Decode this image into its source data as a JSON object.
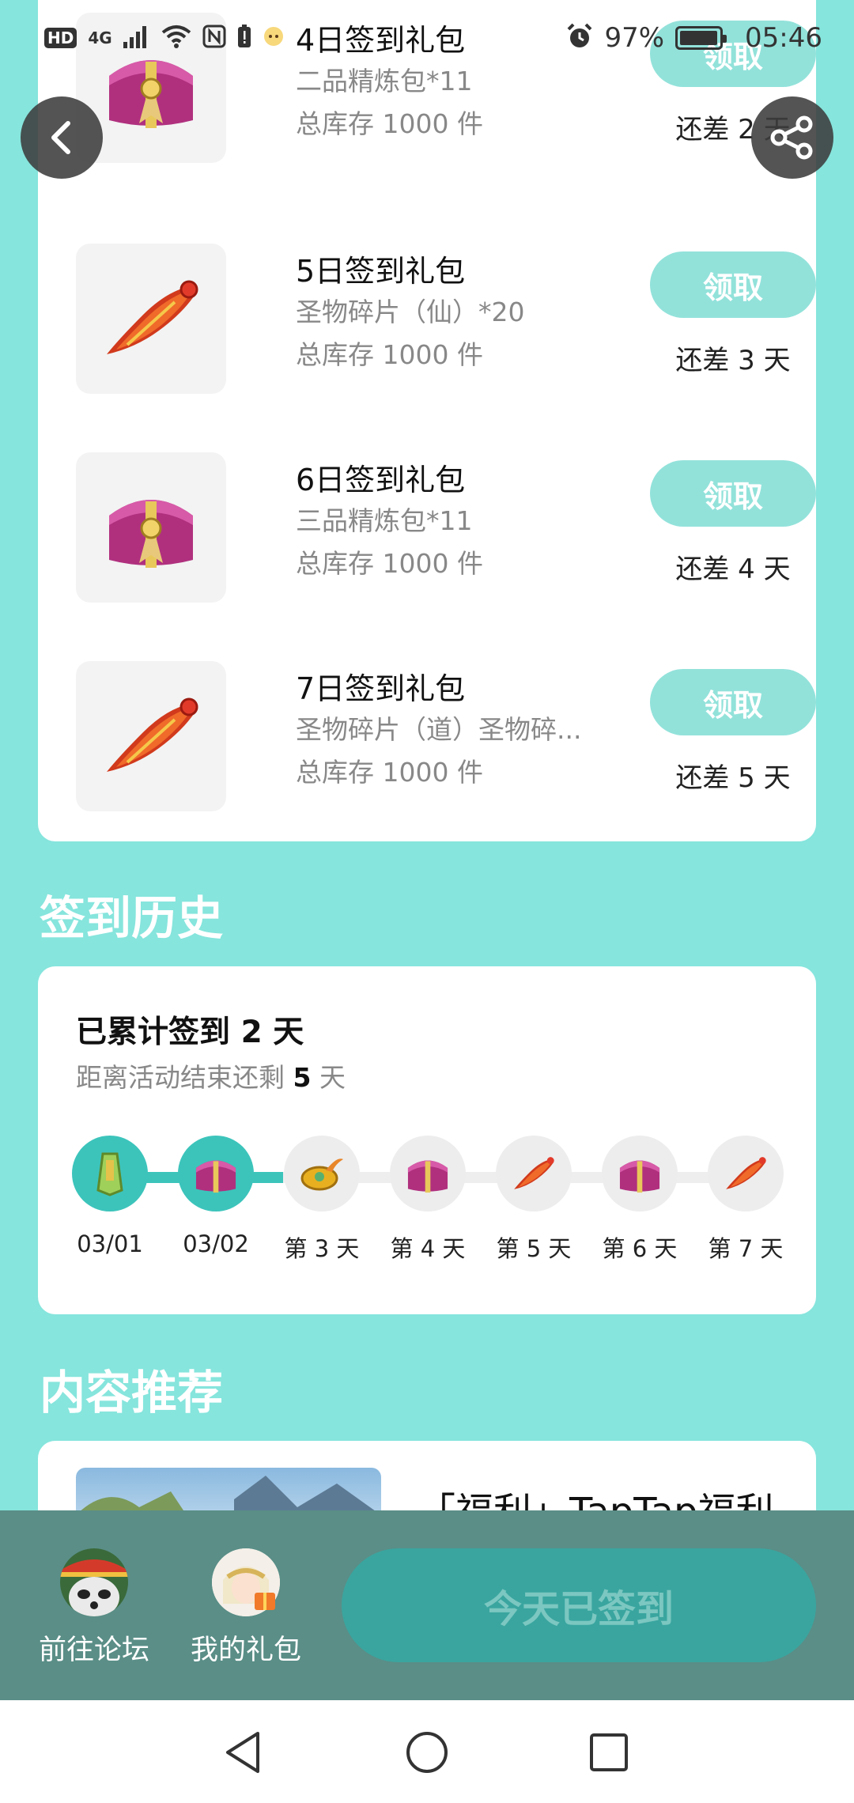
{
  "status_bar": {
    "hd": "HD",
    "network": "4G",
    "battery": "97%",
    "time": "05:46"
  },
  "gifts": [
    {
      "name": "4日签到礼包",
      "desc": "二品精炼包*11",
      "stock": "总库存 1000 件",
      "button": "领取",
      "remaining": "还差 2 天",
      "icon": "treasure-chest"
    },
    {
      "name": "5日签到礼包",
      "desc": "圣物碎片（仙）*20",
      "stock": "总库存 1000 件",
      "button": "领取",
      "remaining": "还差 3 天",
      "icon": "relic-shard"
    },
    {
      "name": "6日签到礼包",
      "desc": "三品精炼包*11",
      "stock": "总库存 1000 件",
      "button": "领取",
      "remaining": "还差 4 天",
      "icon": "treasure-chest"
    },
    {
      "name": "7日签到礼包",
      "desc": "圣物碎片（道）圣物碎...",
      "stock": "总库存 1000 件",
      "button": "领取",
      "remaining": "还差 5 天",
      "icon": "relic-shard"
    }
  ],
  "history": {
    "section_title": "签到历史",
    "title": "已累计签到 2 天",
    "sub_prefix": "距离活动结束还剩 ",
    "sub_days": "5",
    "sub_suffix": " 天",
    "days": [
      {
        "label": "03/01",
        "done": true,
        "icon": "jade-token"
      },
      {
        "label": "03/02",
        "done": true,
        "icon": "treasure-chest"
      },
      {
        "label": "第 3 天",
        "done": false,
        "icon": "gold-ingot"
      },
      {
        "label": "第 4 天",
        "done": false,
        "icon": "treasure-chest"
      },
      {
        "label": "第 5 天",
        "done": false,
        "icon": "relic-shard"
      },
      {
        "label": "第 6 天",
        "done": false,
        "icon": "treasure-chest"
      },
      {
        "label": "第 7 天",
        "done": false,
        "icon": "relic-shard"
      }
    ]
  },
  "recommend": {
    "section_title": "内容推荐",
    "item_title": "「福利」TapTap福利"
  },
  "bottom_bar": {
    "forum_label": "前往论坛",
    "gifts_label": "我的礼包",
    "signed_label": "今天已签到"
  },
  "colors": {
    "background": "#86e5dd",
    "claim_button": "#92e2da",
    "progress": "#3cc4bb",
    "bottom_bar": "#5a8e87"
  }
}
